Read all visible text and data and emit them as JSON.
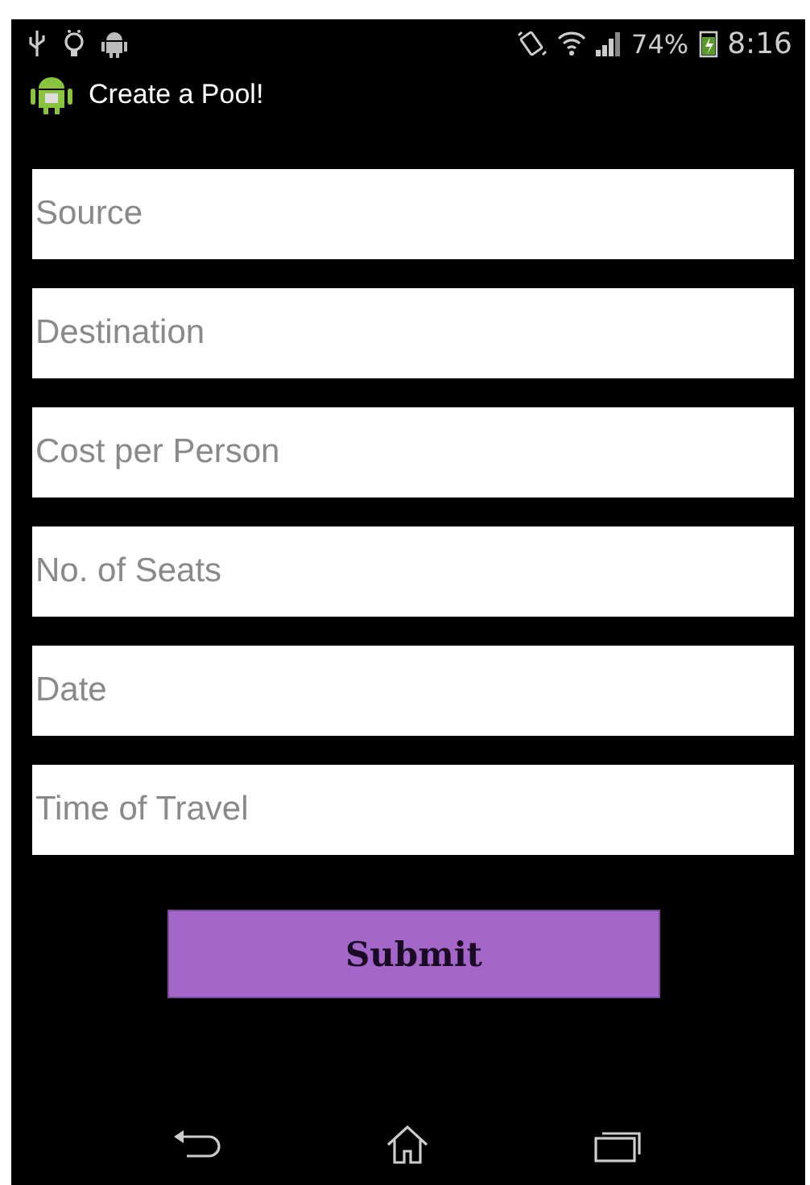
{
  "status_bar": {
    "battery": "74%",
    "time": "8:16"
  },
  "action_bar": {
    "title": "Create a Pool!"
  },
  "fields": [
    {
      "placeholder": "Source"
    },
    {
      "placeholder": "Destination"
    },
    {
      "placeholder": "Cost per Person"
    },
    {
      "placeholder": "No. of Seats"
    },
    {
      "placeholder": "Date"
    },
    {
      "placeholder": "Time of Travel"
    }
  ],
  "submit_button": {
    "label": "Submit"
  }
}
